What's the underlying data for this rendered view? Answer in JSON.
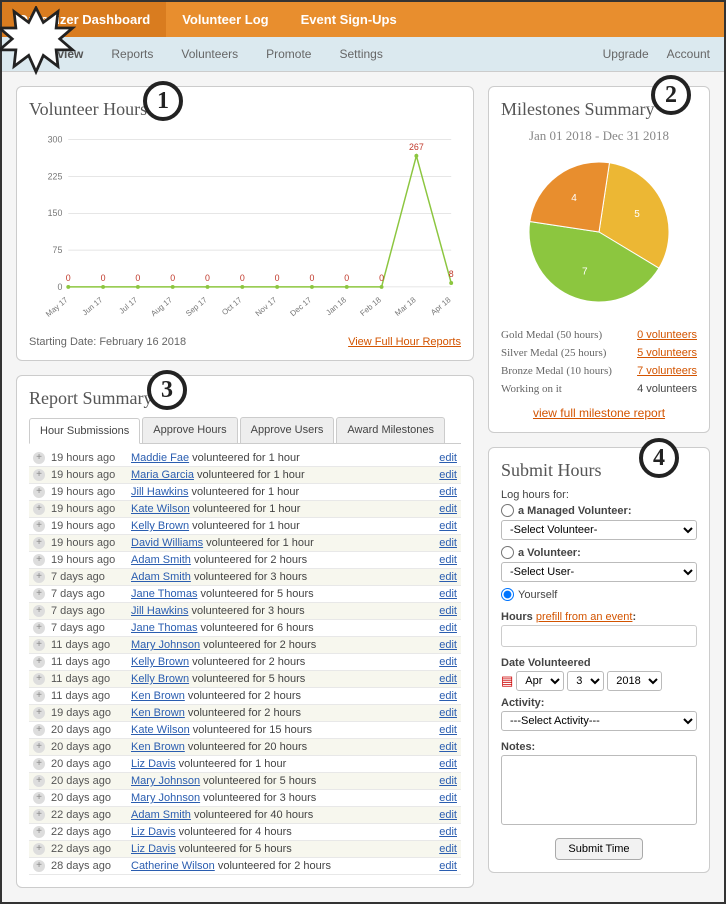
{
  "top_nav": {
    "items": [
      "Organizer Dashboard",
      "Volunteer Log",
      "Event Sign-Ups"
    ],
    "active_index": 0
  },
  "sub_nav": {
    "left": [
      "Overview",
      "Reports",
      "Volunteers",
      "Promote",
      "Settings"
    ],
    "active_index": 0,
    "right": [
      "Upgrade",
      "Account"
    ]
  },
  "volunteer_hours": {
    "title": "Volunteer Hours",
    "starting_text": "Starting Date: February 16 2018",
    "view_full": "View Full Hour Reports"
  },
  "chart_data": {
    "type": "line",
    "categories": [
      "May 17",
      "Jun 17",
      "Jul 17",
      "Aug 17",
      "Sep 17",
      "Oct 17",
      "Nov 17",
      "Dec 17",
      "Jan 18",
      "Feb 18",
      "Mar 18",
      "Apr 18"
    ],
    "values": [
      0,
      0,
      0,
      0,
      0,
      0,
      0,
      0,
      0,
      0,
      267,
      8
    ],
    "ylim": [
      0,
      300
    ],
    "yticks": [
      0,
      75,
      150,
      225,
      300
    ],
    "ylabel": "",
    "xlabel": "",
    "title": "Volunteer Hours"
  },
  "report_summary": {
    "title": "Report Summary",
    "tabs": [
      "Hour Submissions",
      "Approve Hours",
      "Approve Users",
      "Award Milestones"
    ],
    "active_tab": 0,
    "edit_label": "edit",
    "rows": [
      {
        "time": "19 hours ago",
        "user": "Maddie Fae",
        "rest": " volunteered for 1 hour"
      },
      {
        "time": "19 hours ago",
        "user": "Maria Garcia",
        "rest": " volunteered for 1 hour"
      },
      {
        "time": "19 hours ago",
        "user": "Jill Hawkins",
        "rest": " volunteered for 1 hour"
      },
      {
        "time": "19 hours ago",
        "user": "Kate Wilson",
        "rest": " volunteered for 1 hour"
      },
      {
        "time": "19 hours ago",
        "user": "Kelly Brown",
        "rest": " volunteered for 1 hour"
      },
      {
        "time": "19 hours ago",
        "user": "David Williams",
        "rest": " volunteered for 1 hour"
      },
      {
        "time": "19 hours ago",
        "user": "Adam Smith",
        "rest": " volunteered for 2 hours"
      },
      {
        "time": "7 days ago",
        "user": "Adam Smith",
        "rest": " volunteered for 3 hours"
      },
      {
        "time": "7 days ago",
        "user": "Jane Thomas",
        "rest": " volunteered for 5 hours"
      },
      {
        "time": "7 days ago",
        "user": "Jill Hawkins",
        "rest": " volunteered for 3 hours"
      },
      {
        "time": "7 days ago",
        "user": "Jane Thomas",
        "rest": " volunteered for 6 hours"
      },
      {
        "time": "11 days ago",
        "user": "Mary Johnson",
        "rest": " volunteered for 2 hours"
      },
      {
        "time": "11 days ago",
        "user": "Kelly Brown",
        "rest": " volunteered for 2 hours"
      },
      {
        "time": "11 days ago",
        "user": "Kelly Brown",
        "rest": " volunteered for 5 hours"
      },
      {
        "time": "11 days ago",
        "user": "Ken Brown",
        "rest": " volunteered for 2 hours"
      },
      {
        "time": "19 days ago",
        "user": "Ken Brown",
        "rest": " volunteered for 2 hours"
      },
      {
        "time": "20 days ago",
        "user": "Kate Wilson",
        "rest": " volunteered for 15 hours"
      },
      {
        "time": "20 days ago",
        "user": "Ken Brown",
        "rest": " volunteered for 20 hours"
      },
      {
        "time": "20 days ago",
        "user": "Liz Davis",
        "rest": " volunteered for 1 hour"
      },
      {
        "time": "20 days ago",
        "user": "Mary Johnson",
        "rest": " volunteered for 5 hours"
      },
      {
        "time": "20 days ago",
        "user": "Mary Johnson",
        "rest": " volunteered for 3 hours"
      },
      {
        "time": "22 days ago",
        "user": "Adam Smith",
        "rest": " volunteered for 40 hours"
      },
      {
        "time": "22 days ago",
        "user": "Liz Davis",
        "rest": " volunteered for 4 hours"
      },
      {
        "time": "22 days ago",
        "user": "Liz Davis",
        "rest": " volunteered for 5 hours"
      },
      {
        "time": "28 days ago",
        "user": "Catherine Wilson",
        "rest": " volunteered for 2 hours"
      }
    ]
  },
  "milestones": {
    "title": "Milestones Summary",
    "date_range": "Jan 01 2018 - Dec 31 2018",
    "pie": [
      {
        "label": "5",
        "value": 5,
        "color": "#ecb734"
      },
      {
        "label": "7",
        "value": 7,
        "color": "#8cc63f"
      },
      {
        "label": "4",
        "value": 4,
        "color": "#e88e2e"
      }
    ],
    "rows": [
      {
        "label": "Gold Medal (50 hours)",
        "value": "0 volunteers",
        "link": true
      },
      {
        "label": "Silver Medal (25 hours)",
        "value": "5 volunteers",
        "link": true
      },
      {
        "label": "Bronze Medal (10 hours)",
        "value": "7 volunteers",
        "link": true
      },
      {
        "label": "Working on it",
        "value": "4 volunteers",
        "link": false
      }
    ],
    "view_full": "view full milestone report"
  },
  "submit_hours": {
    "title": "Submit Hours",
    "log_for": "Log hours for:",
    "opt_managed": "a Managed Volunteer:",
    "sel_managed": "-Select Volunteer-",
    "opt_vol": "a Volunteer:",
    "sel_vol": "-Select User-",
    "opt_self": "Yourself",
    "hours_label": "Hours",
    "prefill": "prefill from an event",
    "date_label": "Date Volunteered",
    "date_month": "Apr",
    "date_day": "3",
    "date_year": "2018",
    "activity_label": "Activity:",
    "sel_activity": "---Select Activity---",
    "notes_label": "Notes:",
    "submit_btn": "Submit Time"
  },
  "annotations": [
    "1",
    "2",
    "3",
    "4"
  ]
}
